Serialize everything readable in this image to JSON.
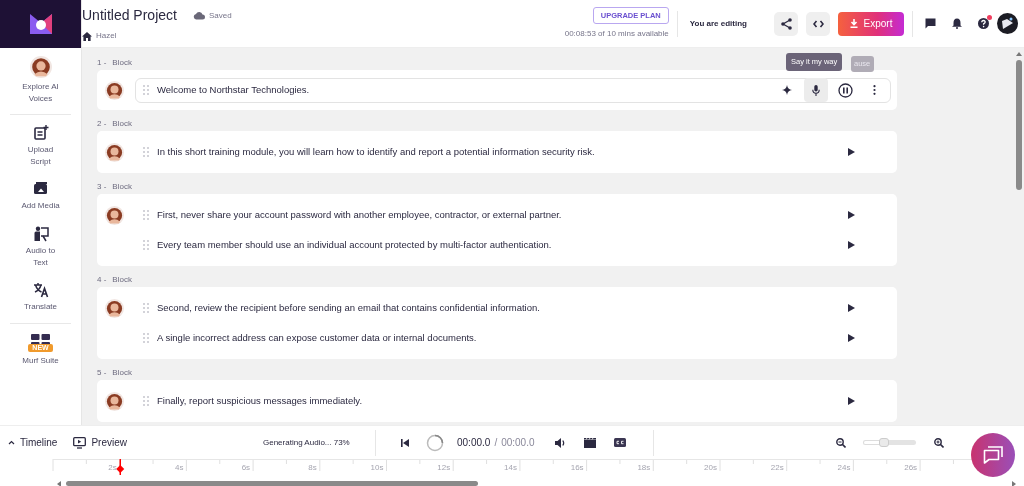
{
  "header": {
    "title": "Untitled Project",
    "save_status": "Saved",
    "voice": "Hazel",
    "upgrade_button": "UPGRADE PLAN",
    "usage": "00:08:53 of 10 mins available",
    "editing_status": "You are editing",
    "export_button": "Export",
    "help_notification": true
  },
  "sidebar": {
    "items": [
      {
        "label": "Explore AI Voices",
        "kind": "voices"
      },
      {
        "label": "Upload Script",
        "kind": "upload"
      },
      {
        "label": "Add Media",
        "kind": "media"
      },
      {
        "label": "Audio to Text",
        "kind": "transcribe"
      },
      {
        "label": "Translate",
        "kind": "translate"
      },
      {
        "label": "Murf Suite",
        "kind": "suite",
        "badge": "NEW"
      }
    ]
  },
  "tooltips": [
    {
      "text": "Say it my way",
      "kind": "primary"
    },
    {
      "text": "ause",
      "kind": "faded"
    }
  ],
  "blocks": [
    {
      "number": "1 -",
      "label": "Block",
      "editor": {
        "mic_active": true
      },
      "lines": [
        {
          "text": "Welcome to Northstar Technologies."
        }
      ]
    },
    {
      "number": "2 -",
      "label": "Block",
      "lines": [
        {
          "text": "In this short training module, you will learn how to identify and report a potential information security risk."
        }
      ]
    },
    {
      "number": "3 -",
      "label": "Block",
      "lines": [
        {
          "text": "First, never share your account password with another employee, contractor, or external partner."
        },
        {
          "text": "Every team member should use an individual account protected by multi-factor authentication."
        }
      ]
    },
    {
      "number": "4 -",
      "label": "Block",
      "lines": [
        {
          "text": "Second, review the recipient before sending an email that contains confidential information."
        },
        {
          "text": "A single incorrect address can expose customer data or internal documents."
        }
      ]
    },
    {
      "number": "5 -",
      "label": "Block",
      "lines": [
        {
          "text": "Finally, report suspicious messages immediately."
        }
      ]
    }
  ],
  "player": {
    "timeline_toggle": "Timeline",
    "preview": "Preview",
    "generating": "Generating Audio... 73%",
    "current_time": "00:00.0",
    "separator": "/",
    "total_time": "00:00.0",
    "zoom": {
      "level": 0.4
    }
  },
  "timeline": {
    "ticks": [
      "2s",
      "4s",
      "6s",
      "8s",
      "10s",
      "12s",
      "14s",
      "16s",
      "18s",
      "20s",
      "22s",
      "24s",
      "26s"
    ],
    "playhead": {
      "level": 0.07
    }
  }
}
